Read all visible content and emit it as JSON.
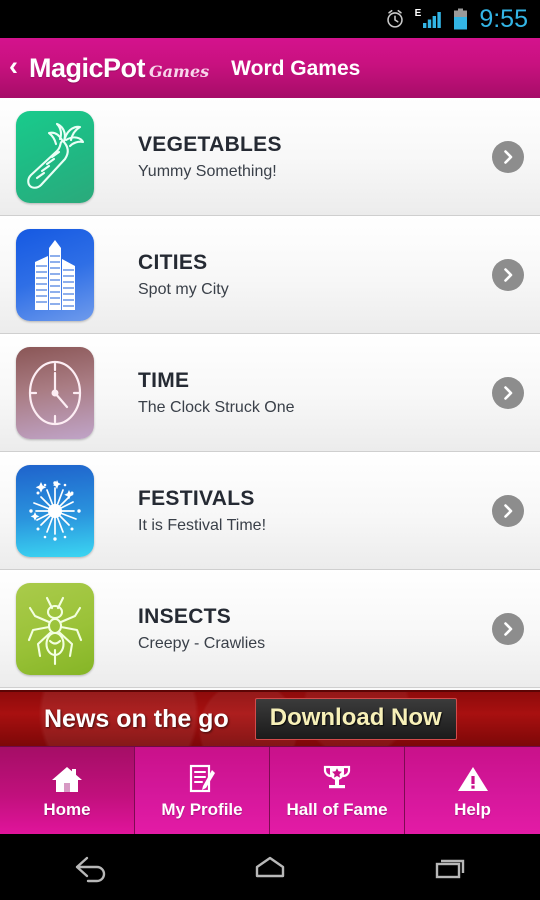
{
  "status_bar": {
    "time": "9:55",
    "network_type": "E",
    "icons": [
      "alarm-icon",
      "signal-icon",
      "battery-icon"
    ],
    "time_color": "#33b5e5"
  },
  "app_bar": {
    "back_label": "‹",
    "logo_main": "MagicPot",
    "logo_sub": "Games",
    "title": "Word Games",
    "accent_color": "#c8117f"
  },
  "list": {
    "items": [
      {
        "title": "VEGETABLES",
        "subtitle": "Yummy Something!",
        "icon": "carrot-icon",
        "tile_color_start": "#18c98a",
        "tile_color_end": "#2aa679"
      },
      {
        "title": "CITIES",
        "subtitle": "Spot my City",
        "icon": "skyscraper-icon",
        "tile_color_start": "#1b5fe0",
        "tile_color_end": "#5e8ee8"
      },
      {
        "title": "TIME",
        "subtitle": "The Clock Struck One",
        "icon": "clock-icon",
        "tile_color_start": "#8d5b5b",
        "tile_color_end": "#bba0c4"
      },
      {
        "title": "FESTIVALS",
        "subtitle": "It is Festival Time!",
        "icon": "fireworks-icon",
        "tile_color_start": "#2269cf",
        "tile_color_end": "#38d2ef"
      },
      {
        "title": "INSECTS",
        "subtitle": "Creepy - Crawlies",
        "icon": "ant-icon",
        "tile_color_start": "#a5c742",
        "tile_color_end": "#8fbb2b"
      }
    ],
    "chevron_icon": "chevron-right-icon"
  },
  "ad": {
    "headline": "News on the go",
    "button_label": "Download Now",
    "background_color": "#a81010",
    "button_text_color": "#f7f0b8"
  },
  "bottom_tabs": {
    "items": [
      {
        "label": "Home",
        "icon": "home-icon",
        "active": true
      },
      {
        "label": "My Profile",
        "icon": "profile-document-icon",
        "active": false
      },
      {
        "label": "Hall of Fame",
        "icon": "trophy-icon",
        "active": false
      },
      {
        "label": "Help",
        "icon": "warning-triangle-icon",
        "active": false
      }
    ]
  },
  "system_nav": {
    "buttons": [
      {
        "name": "back-icon"
      },
      {
        "name": "home-icon"
      },
      {
        "name": "recents-icon"
      }
    ]
  }
}
